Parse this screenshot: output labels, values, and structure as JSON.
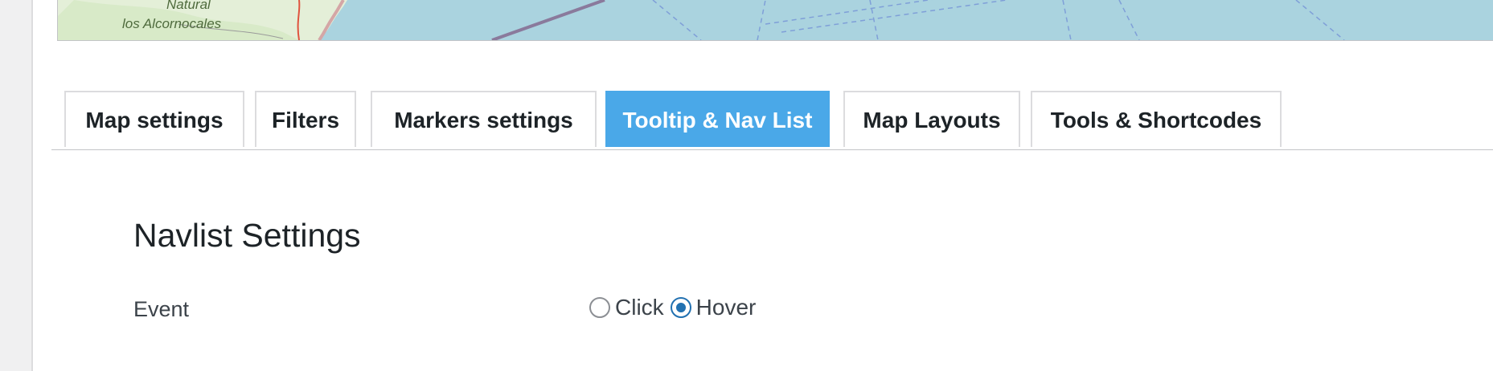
{
  "map": {
    "labels": [
      "Natural",
      "los Alcornocales"
    ],
    "water_color": "#aad3df"
  },
  "tabs": [
    {
      "label": "Map settings",
      "active": false
    },
    {
      "label": "Filters",
      "active": false
    },
    {
      "label": "Markers settings",
      "active": false
    },
    {
      "label": "Tooltip & Nav List",
      "active": true
    },
    {
      "label": "Map Layouts",
      "active": false
    },
    {
      "label": "Tools & Shortcodes",
      "active": false
    }
  ],
  "section": {
    "title": "Navlist Settings"
  },
  "event_field": {
    "label": "Event",
    "options": [
      {
        "label": "Click",
        "checked": false
      },
      {
        "label": "Hover",
        "checked": true
      }
    ]
  },
  "colors": {
    "active_tab": "#4aa8e8",
    "radio_checked": "#2271b1"
  }
}
